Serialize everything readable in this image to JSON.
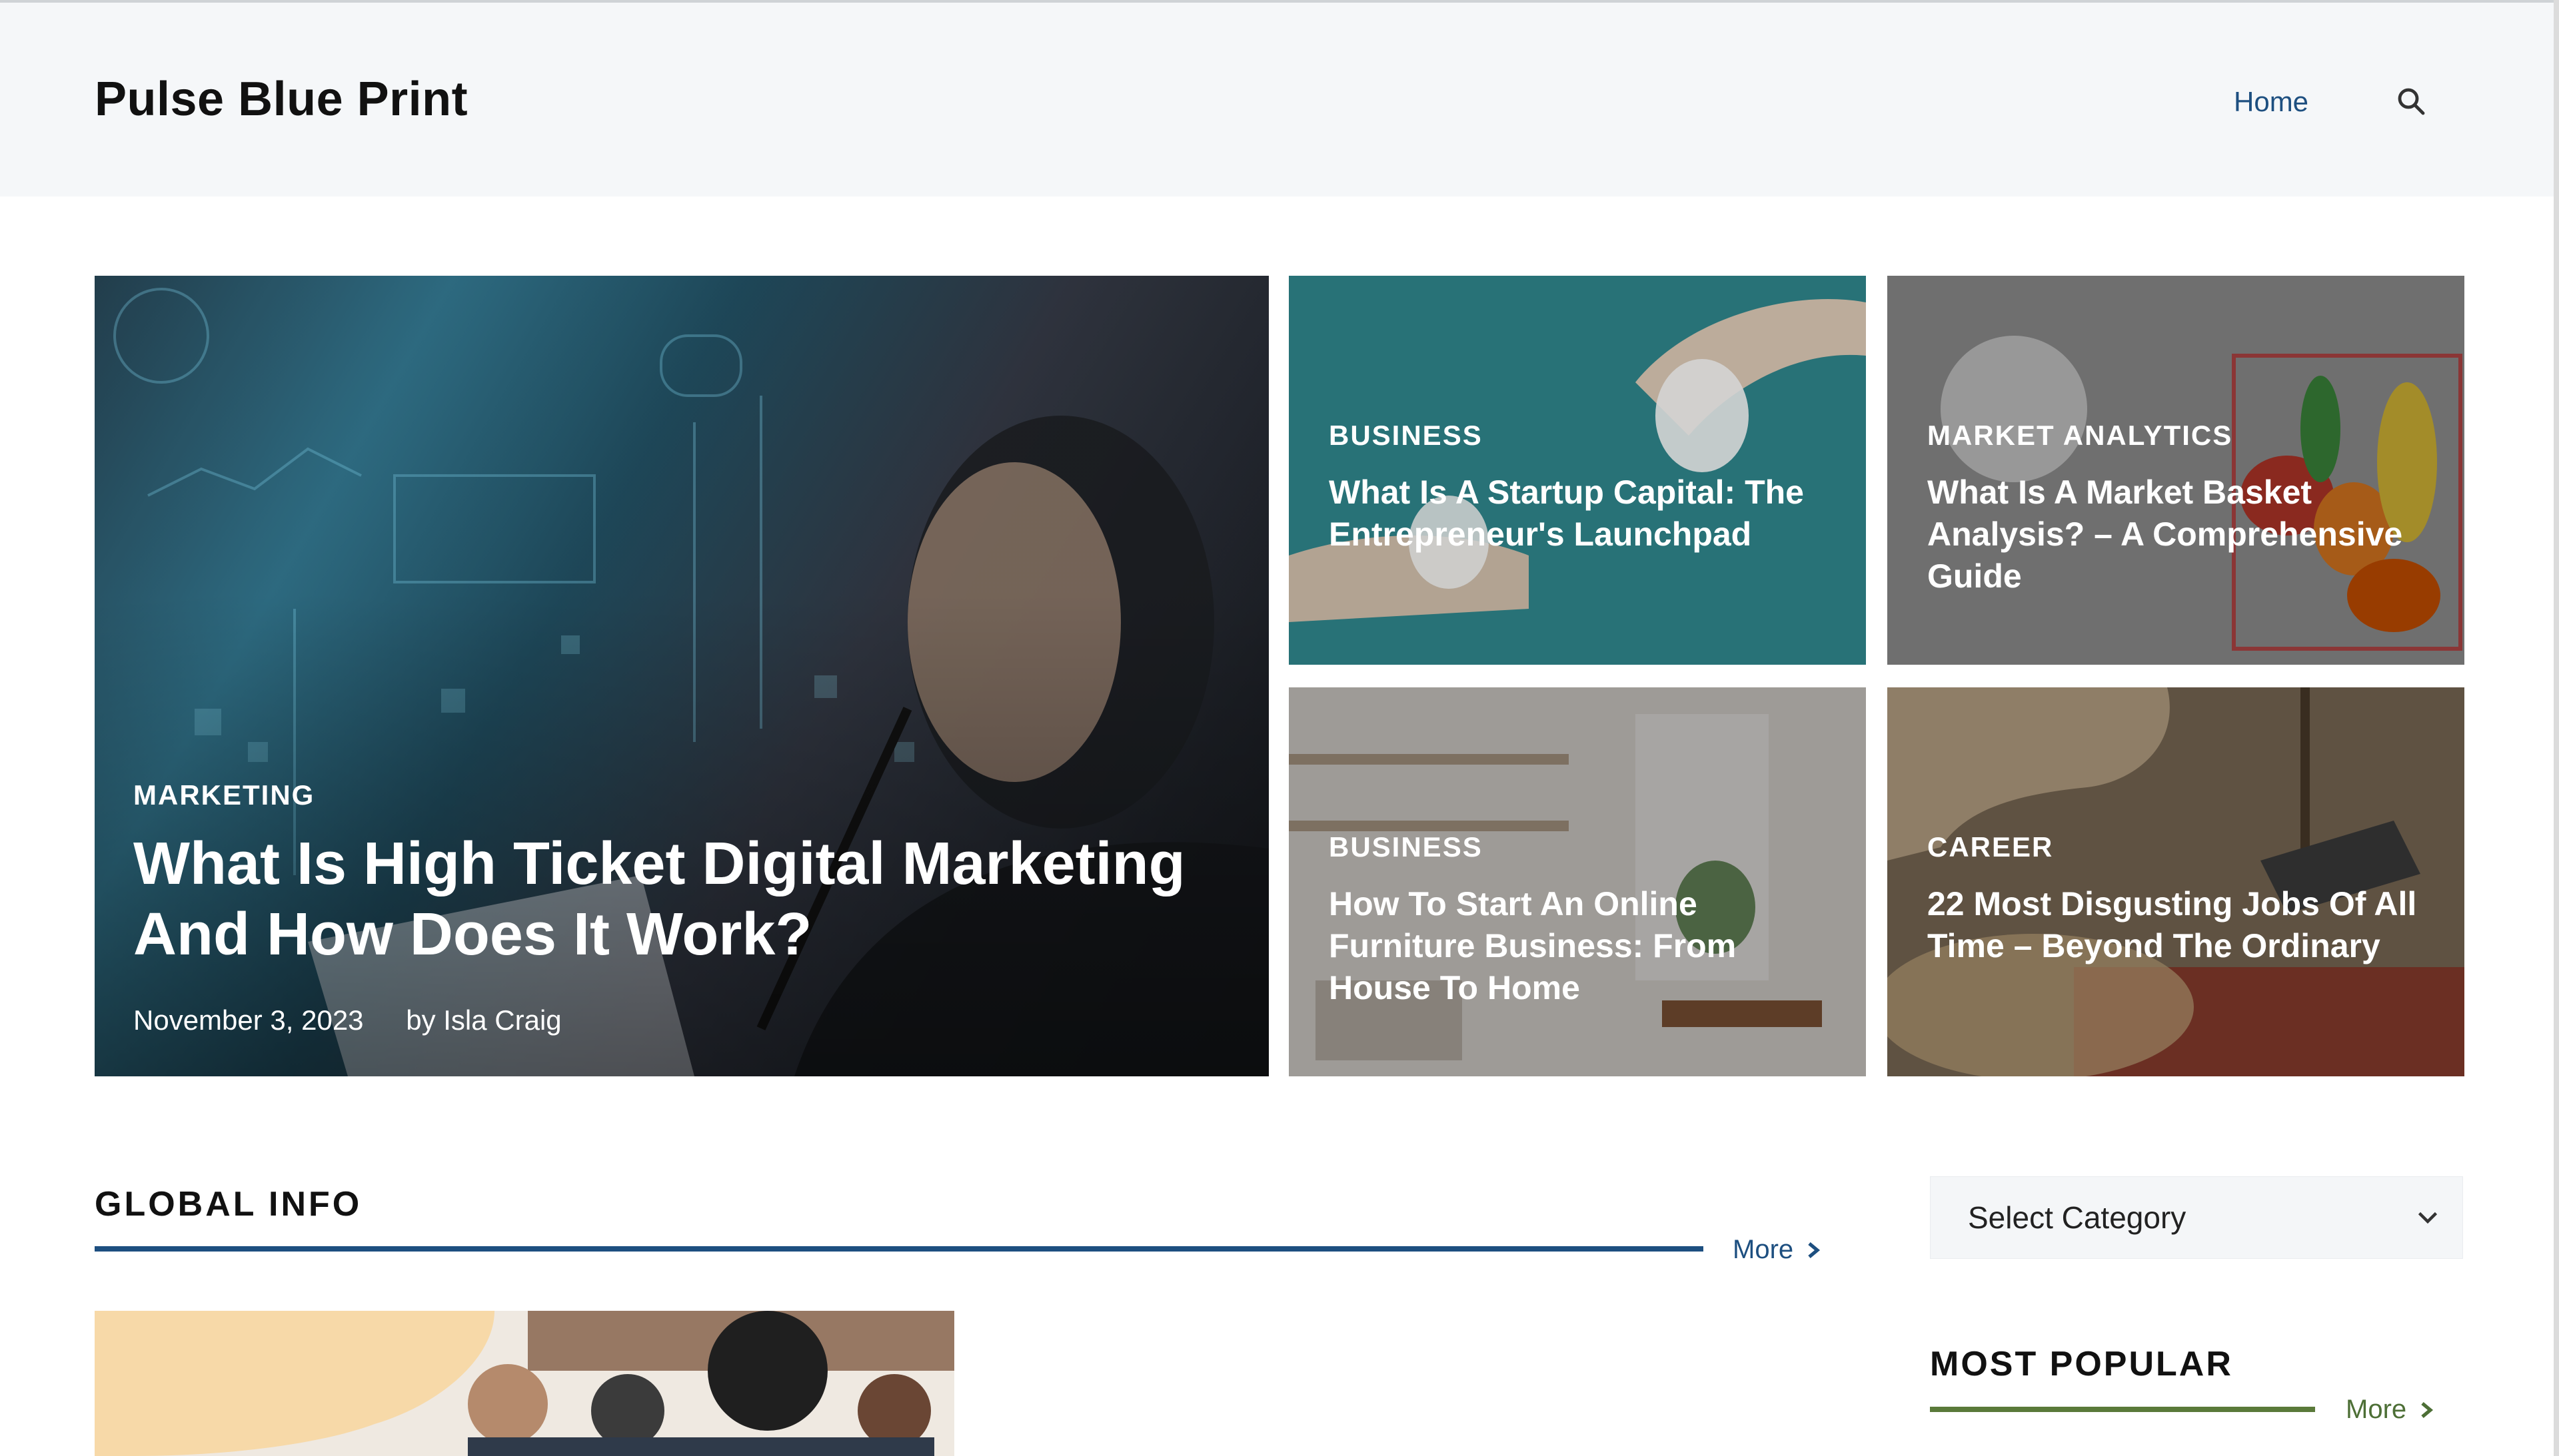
{
  "header": {
    "site_title": "Pulse Blue Print",
    "nav": [
      {
        "label": "Home"
      }
    ],
    "search_icon": "search-icon"
  },
  "hero": {
    "main": {
      "category": "MARKETING",
      "title": "What Is High Ticket Digital Marketing And How Does It Work?",
      "date": "November 3, 2023",
      "author": "by Isla Craig"
    },
    "cards": [
      {
        "category": "BUSINESS",
        "title": "What Is A Startup Capital: The Entrepreneur's Launchpad"
      },
      {
        "category": "MARKET ANALYTICS",
        "title": "What Is A Market Basket Analysis? – A Comprehensive Guide"
      },
      {
        "category": "BUSINESS",
        "title": "How To Start An Online Furniture Business: From House To Home"
      },
      {
        "category": "CAREER",
        "title": "22 Most Disgusting Jobs Of All Time – Beyond The Ordinary"
      }
    ]
  },
  "global_info": {
    "title": "GLOBAL INFO",
    "more_label": "More"
  },
  "sidebar": {
    "select_placeholder": "Select Category",
    "most_popular_title": "MOST POPULAR",
    "more_label": "More"
  },
  "colors": {
    "accent_blue": "#1d4f80",
    "accent_green": "#5a7a3a",
    "header_bg": "#f5f7f9"
  }
}
